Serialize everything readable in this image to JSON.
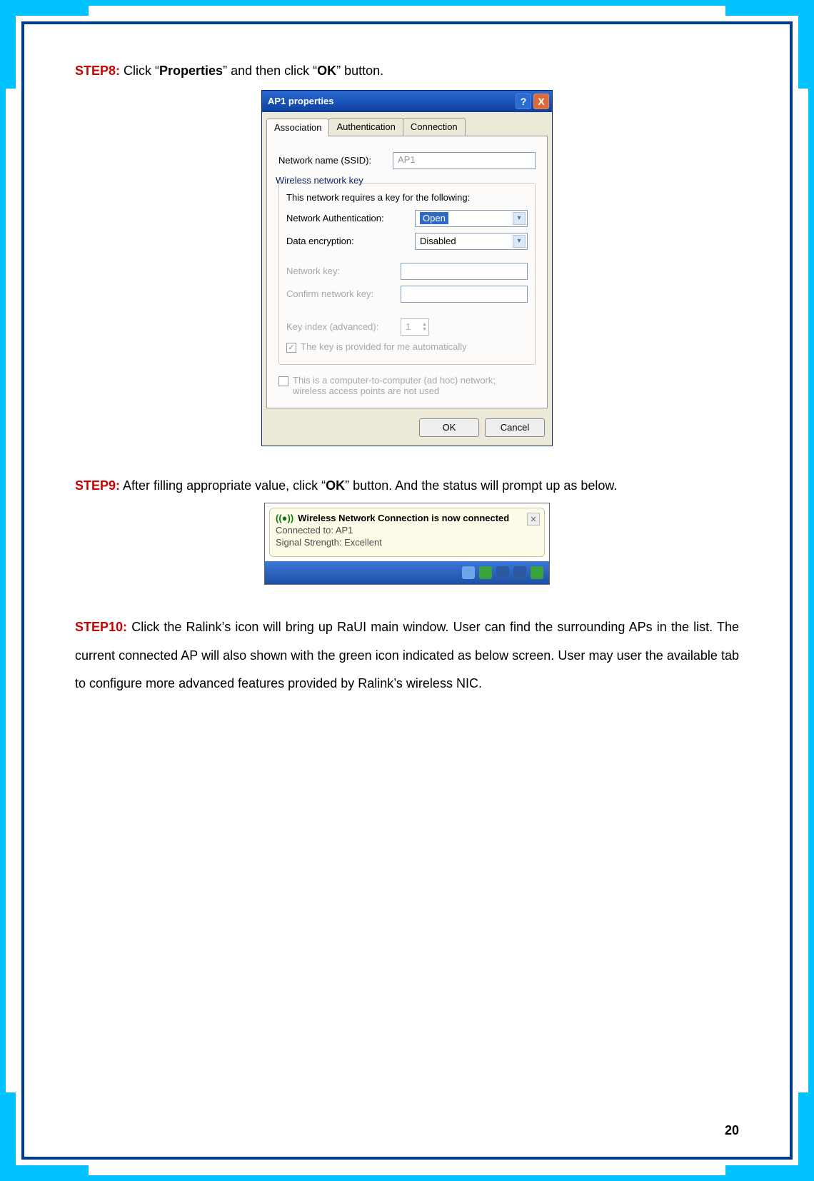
{
  "step8": {
    "label": "STEP8:",
    "text_before": " Click “",
    "bold1": "Properties",
    "text_mid": "” and then click “",
    "bold2": "OK",
    "text_after": "” button."
  },
  "dialog": {
    "title": "AP1 properties",
    "help_char": "?",
    "close_char": "X",
    "tabs": {
      "t1": "Association",
      "t2": "Authentication",
      "t3": "Connection"
    },
    "ssid_label": "Network name (SSID):",
    "ssid_value": "AP1",
    "fieldset_title": "Wireless network key",
    "requires_text": "This network requires a key for the following:",
    "auth_label": "Network Authentication:",
    "auth_value": "Open",
    "enc_label": "Data encryption:",
    "enc_value": "Disabled",
    "key_label": "Network key:",
    "confirm_key_label": "Confirm network key:",
    "key_index_label": "Key index (advanced):",
    "key_index_value": "1",
    "auto_key_label": "The key is provided for me automatically",
    "adhoc_label": "This is a computer-to-computer (ad hoc) network; wireless access points are not used",
    "ok_btn": "OK",
    "cancel_btn": "Cancel"
  },
  "step9": {
    "label": "STEP9:",
    "text_before": " After filling appropriate value, click “",
    "bold1": "OK",
    "text_after": "” button. And the status will prompt up as below."
  },
  "balloon": {
    "title": "Wireless Network Connection is now connected",
    "line1": "Connected to: AP1",
    "line2": "Signal Strength: Excellent"
  },
  "step10": {
    "label": "STEP10:",
    "text": " Click the Ralink’s icon will bring up RaUI main window. User can find the surrounding APs in the list. The current connected AP will also shown with the green icon indicated as below screen. User may user the available tab to configure more advanced features provided by Ralink’s wireless NIC."
  },
  "page_number": "20"
}
